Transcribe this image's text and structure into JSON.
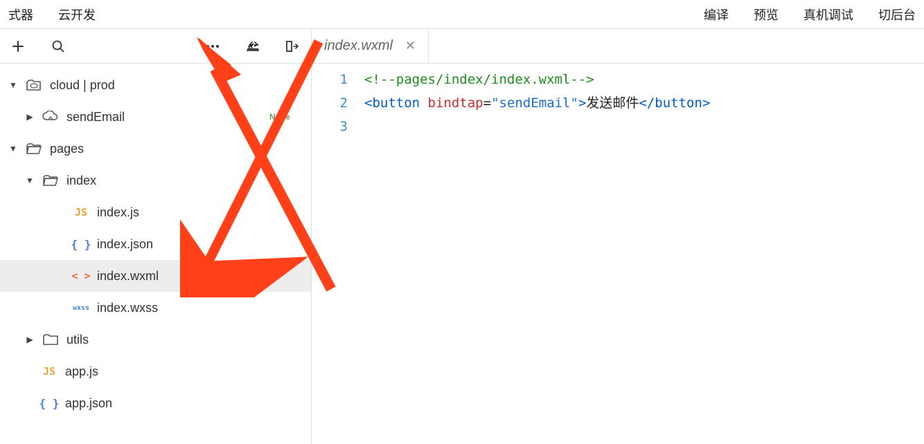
{
  "topMenu": {
    "left": [
      "式器",
      "云开发"
    ],
    "right": [
      "编译",
      "预览",
      "真机调试",
      "切后台"
    ]
  },
  "sidebar": {
    "tree": [
      {
        "type": "folder",
        "expanded": true,
        "icon": "cloud",
        "label": "cloud | prod",
        "indent": 0,
        "badge": ""
      },
      {
        "type": "folder",
        "expanded": false,
        "icon": "cloud-fn",
        "label": "sendEmail",
        "indent": 1,
        "badge": "Node"
      },
      {
        "type": "folder",
        "expanded": true,
        "icon": "folder",
        "label": "pages",
        "indent": 0,
        "badge": ""
      },
      {
        "type": "folder",
        "expanded": true,
        "icon": "folder",
        "label": "index",
        "indent": 1,
        "badge": ""
      },
      {
        "type": "file",
        "icon": "js",
        "label": "index.js",
        "indent": 3
      },
      {
        "type": "file",
        "icon": "json",
        "label": "index.json",
        "indent": 3
      },
      {
        "type": "file",
        "icon": "wxml",
        "label": "index.wxml",
        "indent": 3,
        "active": true
      },
      {
        "type": "file",
        "icon": "wxss",
        "label": "index.wxss",
        "indent": 3
      },
      {
        "type": "folder",
        "expanded": false,
        "icon": "folder-c",
        "label": "utils",
        "indent": 1
      },
      {
        "type": "file",
        "icon": "js",
        "label": "app.js",
        "indent": 2
      },
      {
        "type": "file",
        "icon": "json",
        "label": "app.json",
        "indent": 2
      }
    ]
  },
  "editor": {
    "tabs": [
      {
        "label": "index.wxml",
        "active": true
      }
    ],
    "lineNumbers": [
      "1",
      "2",
      "3"
    ],
    "code": {
      "line1_comment": "<!--pages/index/index.wxml-->",
      "line2": {
        "openBracket": "<",
        "tag": "button",
        "space": " ",
        "attr": "bindtap",
        "eq": "=",
        "strOpen": "\"",
        "strVal": "sendEmail",
        "strClose": "\"",
        "closeOpen": ">",
        "text": "发送邮件",
        "closeTagOpen": "</",
        "closeTag": "button",
        "closeTagEnd": ">"
      }
    }
  }
}
